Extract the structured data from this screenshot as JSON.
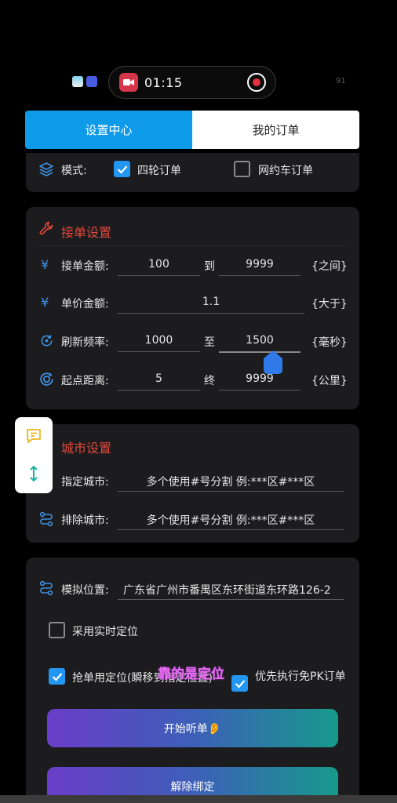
{
  "status_bar": {
    "recording_time": "01:15",
    "battery": "91"
  },
  "tabs": [
    {
      "label": "设置中心",
      "active": true
    },
    {
      "label": "我的订单",
      "active": false
    }
  ],
  "mode": {
    "label": "模式:",
    "options": [
      {
        "label": "四轮订单",
        "checked": true
      },
      {
        "label": "网约车订单",
        "checked": false
      }
    ]
  },
  "order_settings": {
    "title": "接单设置",
    "rows": [
      {
        "label": "接单金额:",
        "from": "100",
        "sep": "到",
        "to": "9999",
        "unit": "{之间}"
      },
      {
        "label": "单价金额:",
        "value": "1.1",
        "unit": "{大于}"
      },
      {
        "label": "刷新频率:",
        "from": "1000",
        "sep": "至",
        "to": "1500",
        "unit": "{毫秒}"
      },
      {
        "label": "起点距离:",
        "from": "5",
        "sep": "终",
        "to": "9999",
        "unit": "{公里}"
      }
    ]
  },
  "city_settings": {
    "title": "城市设置",
    "specify_label": "指定城市:",
    "specify_placeholder": "多个使用#号分割 例:***区#***区",
    "exclude_label": "排除城市:",
    "exclude_placeholder": "多个使用#号分割 例:***区#***区"
  },
  "location": {
    "label": "模拟位置:",
    "value": "广东省广州市番禺区东环街道东环路126-2",
    "realtime": {
      "label": "采用实时定位",
      "checked": false
    },
    "grab": {
      "label": "抢单用定位(瞬移到指定位置)",
      "checked": true
    },
    "pk": {
      "label": "优先执行免PK订单",
      "checked": true
    },
    "overlay_text": "靠的是定位"
  },
  "buttons": {
    "start": "开始听单👂",
    "unbind": "解除绑定"
  },
  "colors": {
    "accent_blue": "#0d9ae8",
    "section_red": "#e0473b",
    "checkbox_blue": "#2196f3",
    "card_bg": "#1c1c1e"
  },
  "icons": [
    "layers-icon",
    "wrench-icon",
    "yen-icon",
    "refresh-icon",
    "target-icon",
    "route-icon",
    "chat-icon",
    "vertical-arrows-icon",
    "record-icon",
    "stop-icon"
  ]
}
